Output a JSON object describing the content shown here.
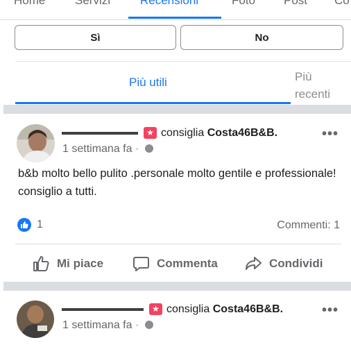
{
  "top_nav": {
    "tabs": [
      {
        "label": "Home"
      },
      {
        "label": "Servizi"
      },
      {
        "label": "Recensioni",
        "active": true
      },
      {
        "label": "Foto"
      },
      {
        "label": "Post"
      },
      {
        "label": "Co"
      }
    ]
  },
  "recommend_prompt": {
    "yes_label": "Sì",
    "no_label": "No"
  },
  "sort": {
    "most_useful": "Più utili",
    "most_recent": "Più recenti"
  },
  "colors": {
    "accent": "#1877f2",
    "recommend_badge": "#f3425f",
    "muted_text": "#65676b"
  },
  "posts": [
    {
      "recommends_text": "consiglia",
      "page_name": "Costa46B&B.",
      "time": "1 settimana fa",
      "body": "b&b molto bello  pulito  .personale molto gentile e professionale! consiglio a tutti.",
      "like_count": "1",
      "comments": "Commenti: 1",
      "actions": {
        "like": "Mi piace",
        "comment": "Commenta",
        "share": "Condividi"
      }
    },
    {
      "recommends_text": "consiglia",
      "page_name": "Costa46B&B.",
      "time": "1 settimana fa"
    }
  ]
}
